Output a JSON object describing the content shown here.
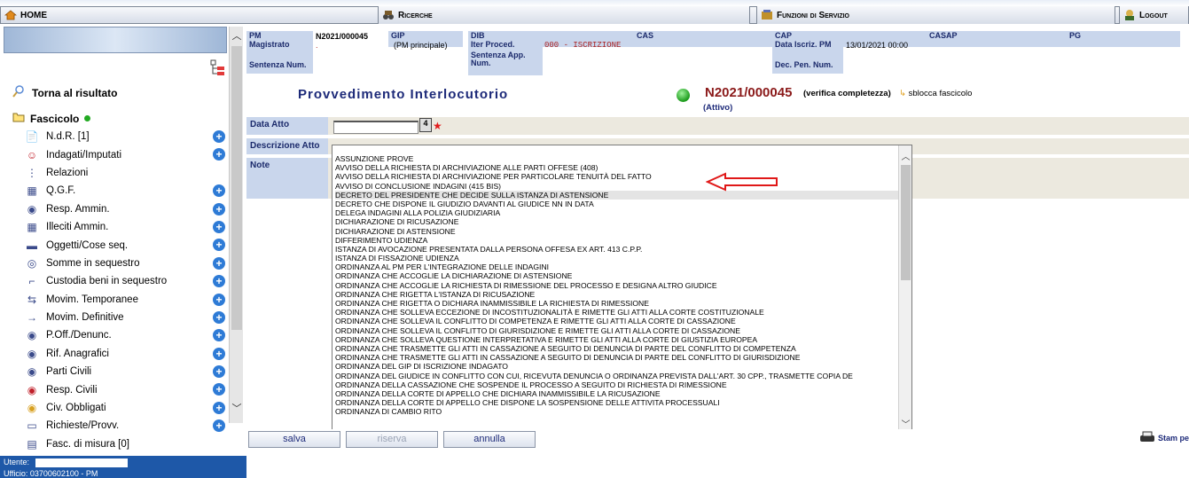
{
  "nav": {
    "home": "HOME",
    "ricerche": "Ricerche",
    "funzioni": "Funzioni di Servizio",
    "logout": "Logout"
  },
  "sidebar": {
    "torna": "Torna al risultato",
    "fascicolo": "Fascicolo",
    "items": [
      {
        "label": "N.d.R. [1]",
        "plus": true
      },
      {
        "label": "Indagati/Imputati",
        "plus": true
      },
      {
        "label": "Relazioni",
        "plus": false
      },
      {
        "label": "Q.G.F.",
        "plus": true
      },
      {
        "label": "Resp. Ammin.",
        "plus": true
      },
      {
        "label": "Illeciti Ammin.",
        "plus": true
      },
      {
        "label": "Oggetti/Cose seq.",
        "plus": true
      },
      {
        "label": "Somme in sequestro",
        "plus": true
      },
      {
        "label": "Custodia beni in sequestro",
        "plus": true
      },
      {
        "label": "Movim. Temporanee",
        "plus": true
      },
      {
        "label": "Movim. Definitive",
        "plus": true
      },
      {
        "label": "P.Off./Denunc.",
        "plus": true
      },
      {
        "label": "Rif. Anagrafici",
        "plus": true
      },
      {
        "label": "Parti Civili",
        "plus": true
      },
      {
        "label": "Resp. Civili",
        "plus": true
      },
      {
        "label": "Civ. Obbligati",
        "plus": true
      },
      {
        "label": "Richieste/Provv.",
        "plus": true
      },
      {
        "label": "Fasc. di misura [0]",
        "plus": false
      }
    ],
    "utente_label": "Utente:",
    "ufficio_label": "Ufficio: 03700602100 - PM"
  },
  "header": {
    "pm_label": "PM",
    "pm_value": "N2021/000045",
    "gip_label": "GIP",
    "dib_label": "DIB",
    "cas_label": "CAS",
    "cap_label": "CAP",
    "casap_label": "CASAP",
    "pg_label": "PG",
    "magistrato_label": "Magistrato",
    "magistrato_value": ".",
    "gip_value": "(PM principale)",
    "iter_label": "Iter Proced.",
    "iter_value": "000 - ISCRIZIONE",
    "data_iscriz_label": "Data Iscriz. PM",
    "data_iscriz_value": "13/01/2021 00:00",
    "sentenza_label": "Sentenza Num.",
    "sentenza_app_label": "Sentenza App. Num.",
    "dec_pen_label": "Dec. Pen. Num."
  },
  "form": {
    "title": "Provvedimento Interlocutorio",
    "pm_code": "N2021/000045",
    "verifica": "(verifica completezza)",
    "sblocca": "sblocca fascicolo",
    "stato": "(Attivo)",
    "data_atto_label": "Data Atto",
    "descrizione_label": "Descrizione Atto",
    "note_label": "Note"
  },
  "dropdown": {
    "selected_index": 4,
    "options": [
      "ASSUNZIONE PROVE",
      "AVVISO DELLA RICHIESTA DI ARCHIVIAZIONE ALLE PARTI OFFESE (408)",
      "AVVISO DELLA RICHIESTA DI ARCHIVIAZIONE PER PARTICOLARE TENUITÀ DEL FATTO",
      "AVVISO DI CONCLUSIONE INDAGINI (415 BIS)",
      "DECRETO DEL PRESIDENTE CHE DECIDE SULLA ISTANZA DI ASTENSIONE",
      "DECRETO CHE DISPONE IL GIUDIZIO DAVANTI AL GIUDICE NN IN DATA",
      "DELEGA INDAGINI ALLA POLIZIA GIUDIZIARIA",
      "DICHIARAZIONE DI RICUSAZIONE",
      "DICHIARAZIONE DI ASTENSIONE",
      "DIFFERIMENTO UDIENZA",
      "ISTANZA DI AVOCAZIONE PRESENTATA DALLA PERSONA OFFESA EX ART. 413 C.P.P.",
      "ISTANZA DI FISSAZIONE UDIENZA",
      "ORDINANZA AL PM PER L'INTEGRAZIONE DELLE INDAGINI",
      "ORDINANZA CHE ACCOGLIE LA DICHIARAZIONE DI ASTENSIONE",
      "ORDINANZA CHE ACCOGLIE LA RICHIESTA DI RIMESSIONE DEL PROCESSO E DESIGNA ALTRO GIUDICE",
      "ORDINANZA CHE RIGETTA L'ISTANZA DI RICUSAZIONE",
      "ORDINANZA CHE RIGETTA O DICHIARA INAMMISSIBILE LA RICHIESTA DI RIMESSIONE",
      "ORDINANZA CHE SOLLEVA ECCEZIONE DI INCOSTITUZIONALITÀ E RIMETTE GLI ATTI ALLA CORTE COSTITUZIONALE",
      "ORDINANZA CHE SOLLEVA IL CONFLITTO DI COMPETENZA E RIMETTE GLI ATTI ALLA CORTE DI CASSAZIONE",
      "ORDINANZA CHE SOLLEVA IL CONFLITTO DI GIURISDIZIONE E RIMETTE GLI ATTI ALLA CORTE DI CASSAZIONE",
      "ORDINANZA CHE SOLLEVA QUESTIONE INTERPRETATIVA E RIMETTE GLI ATTI ALLA CORTE DI GIUSTIZIA EUROPEA",
      "ORDINANZA CHE TRASMETTE GLI ATTI IN CASSAZIONE A SEGUITO DI DENUNCIA DI PARTE DEL CONFLITTO DI COMPETENZA",
      "ORDINANZA CHE TRASMETTE GLI ATTI IN CASSAZIONE A SEGUITO DI DENUNCIA DI PARTE DEL CONFLITTO DI GIURISDIZIONE",
      "ORDINANZA DEL GIP DI ISCRIZIONE INDAGATO",
      "ORDINANZA DEL GIUDICE IN CONFLITTO CON CUI, RICEVUTA DENUNCIA O ORDINANZA PREVISTA DALL'ART. 30 CPP., TRASMETTE COPIA DE",
      "ORDINANZA DELLA CASSAZIONE CHE SOSPENDE IL PROCESSO A SEGUITO DI RICHIESTA DI RIMESSIONE",
      "ORDINANZA DELLA CORTE DI APPELLO CHE DICHIARA INAMMISSIBILE LA RICUSAZIONE",
      "ORDINANZA DELLA CORTE DI APPELLO CHE DISPONE LA SOSPENSIONE DELLE ATTIVITA PROCESSUALI",
      "ORDINANZA DI CAMBIO RITO"
    ]
  },
  "buttons": {
    "salva": "salva",
    "riserva": "riserva",
    "annulla": "annulla",
    "stampa": "Stam pe"
  }
}
